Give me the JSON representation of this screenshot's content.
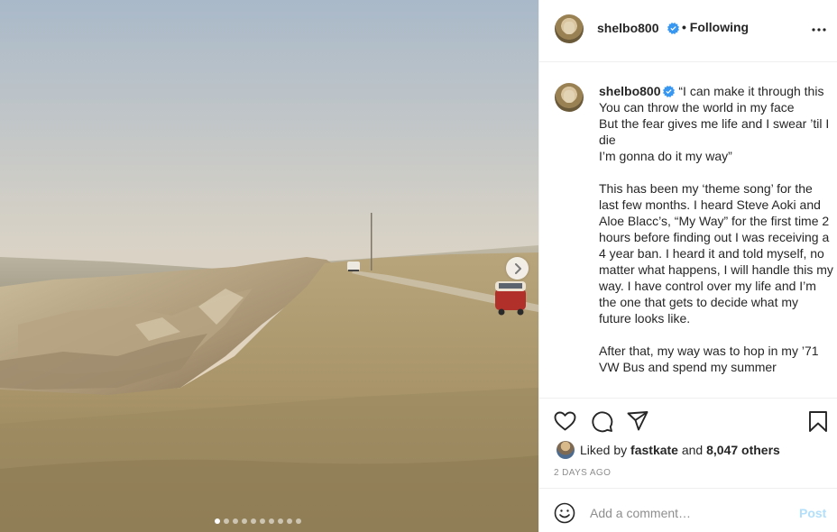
{
  "post": {
    "username": "shelbo800",
    "follow_status": "• Following",
    "verified": true,
    "caption_paragraphs": [
      "“I can make it through this\nYou can throw the world in my face\nBut the fear gives me life and I swear ’til I die\nI’m gonna do it my way”",
      "This has been my ‘theme song’ for the last few months. I heard Steve Aoki and Aloe Blacc’s, “My Way” for the first time 2 hours before finding out I was receiving a 4 year ban. I heard it and told myself, no matter what happens, I will handle this my way. I have control over my life and I’m the one that gets to decide what my future looks like.",
      "After that, my way was to hop in my ’71 VW Bus and spend my summer"
    ],
    "liked_by_prefix": "Liked by",
    "liked_by_user": "fastkate",
    "liked_by_and": "and",
    "liked_by_others": "8,047 others",
    "timestamp": "2 DAYS AGO"
  },
  "carousel": {
    "total_images": 10,
    "active_index": 0
  },
  "comment": {
    "placeholder": "Add a comment…",
    "post_label": "Post"
  },
  "icons": {
    "more": "more-options-icon",
    "verified": "verified-badge-icon",
    "like": "heart-icon",
    "comment": "comment-icon",
    "share": "paper-plane-icon",
    "save": "bookmark-icon",
    "emoji": "emoji-icon",
    "next": "chevron-right-icon"
  },
  "colors": {
    "verified_blue": "#3897f0",
    "post_button_disabled": "#b2dffc",
    "secondary_text": "#8e8e8e",
    "van_red": "#b2302a"
  }
}
